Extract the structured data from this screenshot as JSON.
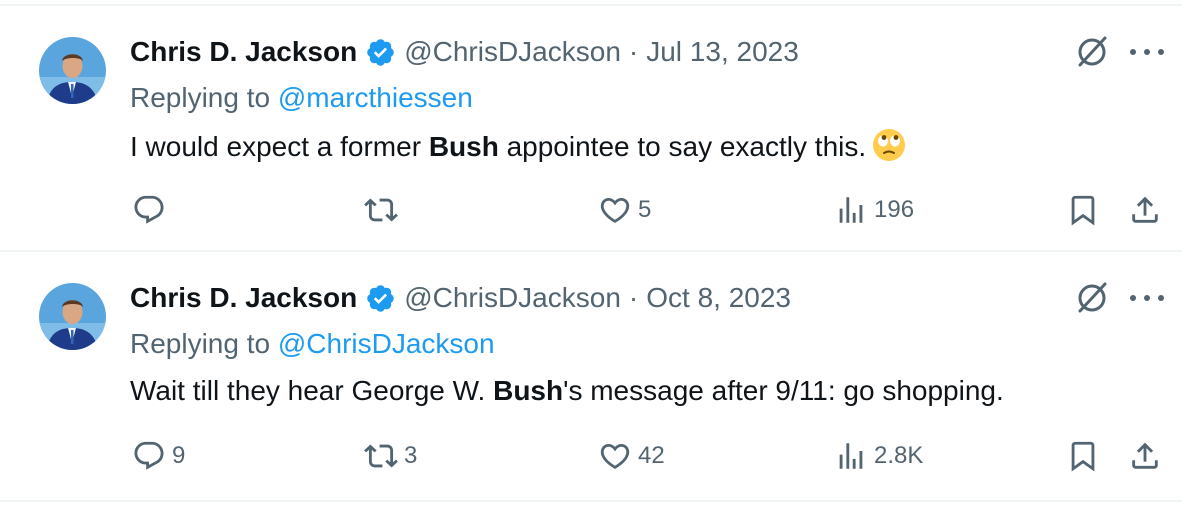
{
  "tweets": [
    {
      "author_name": "Chris D. Jackson",
      "handle": "@ChrisDJackson",
      "separator": "·",
      "date": "Jul 13, 2023",
      "replying_prefix": "Replying to",
      "replying_to": "@marcthiessen",
      "text_before": "I would expect a former ",
      "text_bold": "Bush",
      "text_after": " appointee to say exactly this.",
      "emoji": "face-with-rolling-eyes",
      "replies": "",
      "reposts": "",
      "likes": "5",
      "views": "196"
    },
    {
      "author_name": "Chris D. Jackson",
      "handle": "@ChrisDJackson",
      "separator": "·",
      "date": "Oct 8, 2023",
      "replying_prefix": "Replying to",
      "replying_to": "@ChrisDJackson",
      "text_before": "Wait till they hear George W. ",
      "text_bold": "Bush",
      "text_after": "'s message after 9/11: go shopping.",
      "emoji": "",
      "replies": "9",
      "reposts": "3",
      "likes": "42",
      "views": "2.8K"
    }
  ],
  "colors": {
    "text": "#0f1419",
    "secondary": "#536471",
    "link": "#1d9bf0",
    "verified": "#1d9bf0",
    "divider": "#eff3f4"
  },
  "icons": [
    "verified-badge-icon",
    "grok-icon",
    "more-icon",
    "reply-icon",
    "repost-icon",
    "like-icon",
    "views-icon",
    "bookmark-icon",
    "share-icon"
  ]
}
